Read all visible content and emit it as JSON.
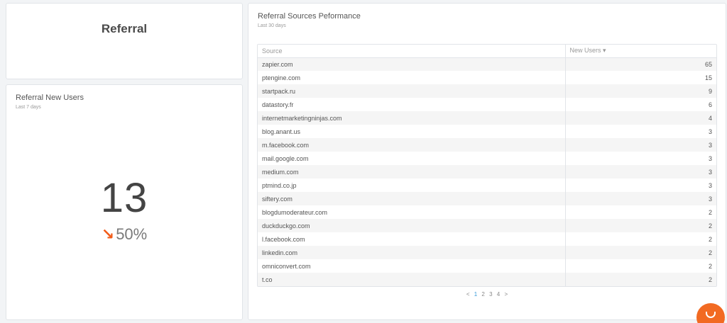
{
  "header": {
    "title": "Referral"
  },
  "new_users_card": {
    "title": "Referral New Users",
    "subtitle": "Last 7 days",
    "value": "13",
    "delta": "50%",
    "delta_direction": "down",
    "delta_color": "#f25c19"
  },
  "sources_card": {
    "title": "Referral Sources Peformance",
    "subtitle": "Last 30 days",
    "columns": [
      "Source",
      "New Users ▾"
    ],
    "rows": [
      {
        "source": "zapier.com",
        "value": "65"
      },
      {
        "source": "ptengine.com",
        "value": "15"
      },
      {
        "source": "startpack.ru",
        "value": "9"
      },
      {
        "source": "datastory.fr",
        "value": "6"
      },
      {
        "source": "internetmarketingninjas.com",
        "value": "4"
      },
      {
        "source": "blog.anant.us",
        "value": "3"
      },
      {
        "source": "m.facebook.com",
        "value": "3"
      },
      {
        "source": "mail.google.com",
        "value": "3"
      },
      {
        "source": "medium.com",
        "value": "3"
      },
      {
        "source": "ptmind.co.jp",
        "value": "3"
      },
      {
        "source": "siftery.com",
        "value": "3"
      },
      {
        "source": "blogdumoderateur.com",
        "value": "2"
      },
      {
        "source": "duckduckgo.com",
        "value": "2"
      },
      {
        "source": "l.facebook.com",
        "value": "2"
      },
      {
        "source": "linkedin.com",
        "value": "2"
      },
      {
        "source": "omniconvert.com",
        "value": "2"
      },
      {
        "source": "t.co",
        "value": "2"
      }
    ],
    "pagination": {
      "prev": "<",
      "pages": [
        "1",
        "2",
        "3",
        "4"
      ],
      "next": ">",
      "current": "1"
    }
  },
  "chat_widget": {
    "icon": "chat-icon",
    "color": "#f26a22"
  }
}
